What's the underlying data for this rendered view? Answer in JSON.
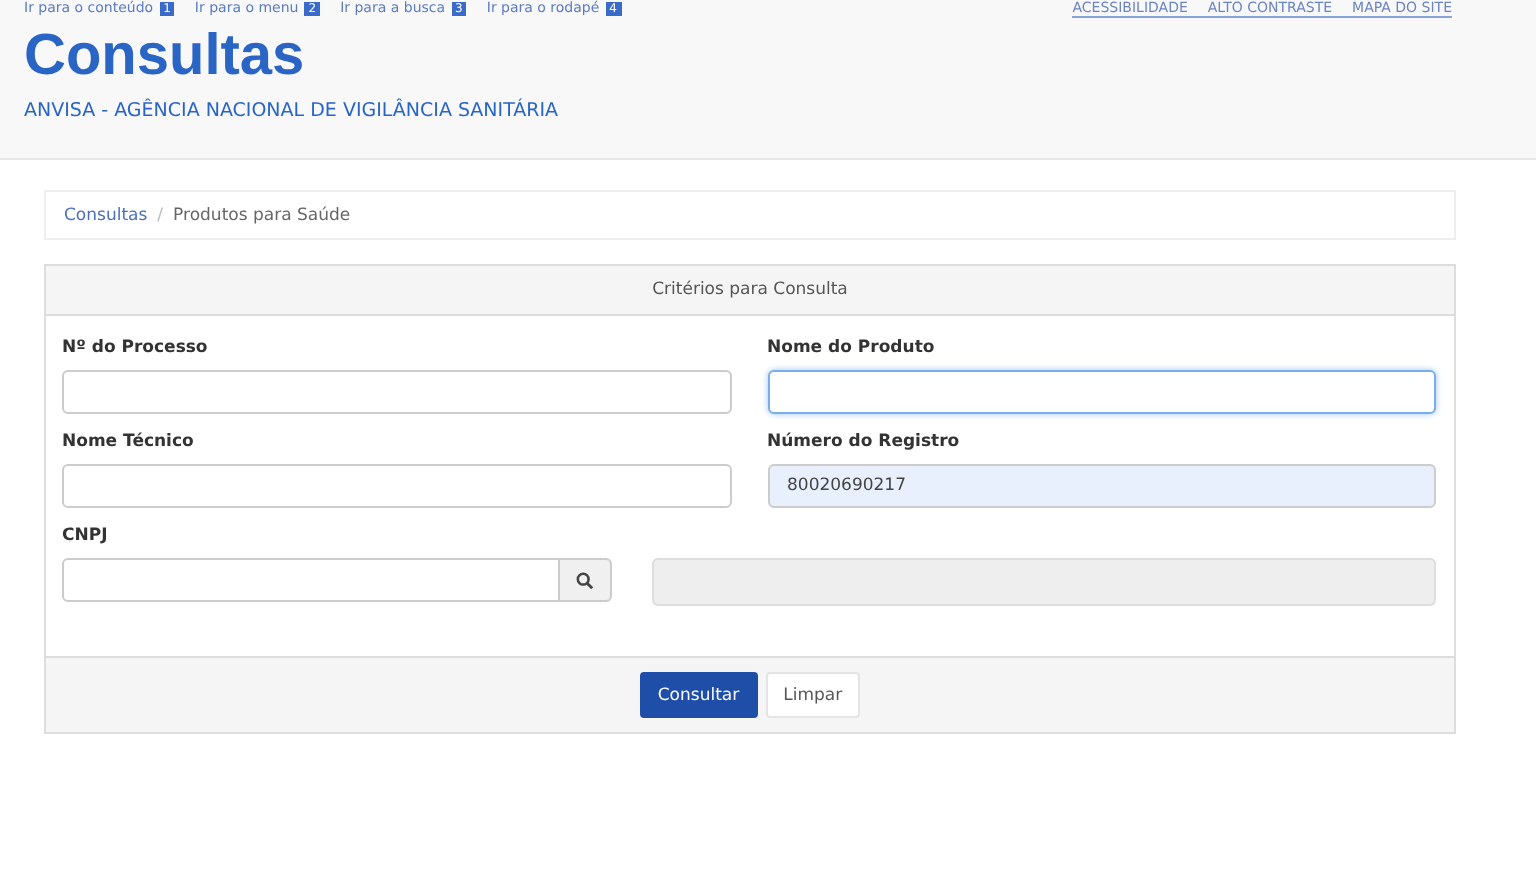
{
  "skip_links": [
    {
      "label": "Ir para o conteúdo",
      "key": "1"
    },
    {
      "label": "Ir para o menu",
      "key": "2"
    },
    {
      "label": "Ir para a busca",
      "key": "3"
    },
    {
      "label": "Ir para o rodapé",
      "key": "4"
    }
  ],
  "top_links": [
    "ACESSIBILIDADE",
    "ALTO CONTRASTE",
    "MAPA DO SITE"
  ],
  "header": {
    "title": "Consultas",
    "subtitle": "ANVISA - AGÊNCIA NACIONAL DE VIGILÂNCIA SANITÁRIA"
  },
  "breadcrumb_separator": "/",
  "breadcrumb": [
    {
      "label": "Consultas",
      "link": true
    },
    {
      "label": "Produtos para Saúde",
      "link": false
    }
  ],
  "panel": {
    "title": "Critérios para Consulta",
    "fields": [
      {
        "label": "Nº do Processo",
        "kind": "text",
        "focused": false,
        "autofilled": false
      },
      {
        "label": "Nome do Produto",
        "kind": "text",
        "focused": true,
        "autofilled": false
      },
      {
        "label": "Nome Técnico",
        "kind": "text",
        "focused": false,
        "autofilled": false
      },
      {
        "label": "Número do Registro",
        "kind": "text",
        "focused": false,
        "autofilled": true,
        "value": "80020690217"
      },
      {
        "label": "CNPJ",
        "kind": "search",
        "focused": false,
        "autofilled": false
      },
      {
        "kind": "disabled",
        "focused": false,
        "autofilled": false
      }
    ],
    "buttons": [
      {
        "label": "Consultar",
        "primary": true
      },
      {
        "label": "Limpar",
        "primary": false
      }
    ]
  }
}
